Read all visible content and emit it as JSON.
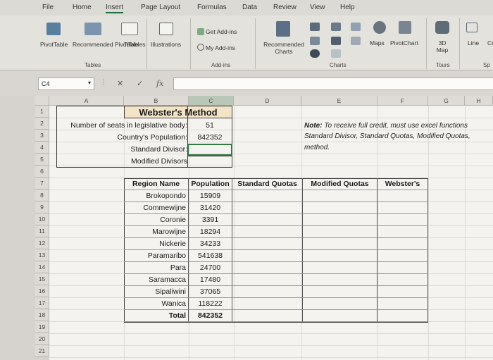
{
  "menu": {
    "tabs": [
      "File",
      "Home",
      "Insert",
      "Page Layout",
      "Formulas",
      "Data",
      "Review",
      "View",
      "Help"
    ],
    "active_tab": "Insert"
  },
  "ribbon": {
    "pivot_table": "PivotTable",
    "recommended_pivot": "Recommended PivotTables",
    "table": "Table",
    "illustrations": "Illustrations",
    "get_addins": "Get Add-ins",
    "my_addins": "My Add-ins",
    "recommended_charts": "Recommended Charts",
    "maps": "Maps",
    "pivot_chart": "PivotChart",
    "map3d": "3D Map",
    "line": "Line",
    "line_cut": "Co",
    "groups": {
      "tables": "Tables",
      "addins": "Add-ins",
      "charts": "Charts",
      "tours": "Tours",
      "spark": "Sp"
    }
  },
  "formula_bar": {
    "name_box": "C4",
    "fx": "fx",
    "cancel": "✕",
    "enter": "✓",
    "value": ""
  },
  "columns": [
    "A",
    "B",
    "C",
    "D",
    "E",
    "F",
    "G",
    "H"
  ],
  "selected_column": "C",
  "rows": [
    "1",
    "2",
    "3",
    "4",
    "5",
    "6",
    "7",
    "8",
    "9",
    "10",
    "11",
    "12",
    "13",
    "14",
    "15",
    "16",
    "17",
    "18",
    "19",
    "20",
    "21"
  ],
  "webster": {
    "title": "Webster's Method",
    "seats_label": "Number of seats in legislative body:",
    "seats_value": "51",
    "population_label": "Country's Population:",
    "population_value": "842352",
    "std_divisor_label": "Standard Divisor:",
    "mod_divisor_label": "Modified Divisors"
  },
  "note": {
    "label": "Note:",
    "line1": "To receive full credit, must use excel functions",
    "line2": "Standard Divisor, Standard Quotas, Modified Quotas,",
    "line3": "method."
  },
  "table": {
    "headers": [
      "Region Name",
      "Population",
      "Standard Quotas",
      "Modified Quotas",
      "Webster's"
    ],
    "rows": [
      {
        "region": "Brokopondo",
        "population": "15909"
      },
      {
        "region": "Commewijne",
        "population": "31420"
      },
      {
        "region": "Coronie",
        "population": "3391"
      },
      {
        "region": "Marowijne",
        "population": "18294"
      },
      {
        "region": "Nickerie",
        "population": "34233"
      },
      {
        "region": "Paramaribo",
        "population": "541638"
      },
      {
        "region": "Para",
        "population": "24700"
      },
      {
        "region": "Saramacca",
        "population": "17480"
      },
      {
        "region": "Sipaliwini",
        "population": "37065"
      },
      {
        "region": "Wanica",
        "population": "118222"
      }
    ],
    "total_label": "Total",
    "total_value": "842352"
  }
}
